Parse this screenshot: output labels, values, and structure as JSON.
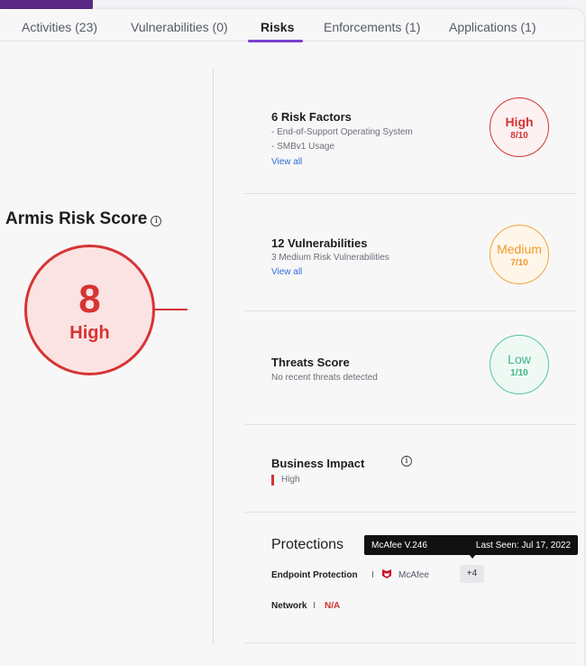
{
  "tabs": [
    {
      "label": "Activities (23)"
    },
    {
      "label": "Vulnerabilities (0)"
    },
    {
      "label": "Risks"
    },
    {
      "label": "Enforcements (1)"
    },
    {
      "label": "Applications (1)"
    }
  ],
  "active_tab": "Risks",
  "score": {
    "title": "Armis Risk Score",
    "info_icon": "i",
    "value": "8",
    "level": "High"
  },
  "risk_factors": {
    "title": "6 Risk Factors",
    "items": [
      "- End-of-Support Operating System",
      "- SMBv1 Usage"
    ],
    "link": "View all",
    "badge_level": "High",
    "badge_score": "8/10"
  },
  "vulnerabilities": {
    "title": "12 Vulnerabilities",
    "subtitle": "3 Medium Risk Vulnerabilities",
    "link": "View all",
    "badge_level": "Medium",
    "badge_score": "7/10"
  },
  "threats": {
    "title": "Threats Score",
    "subtitle": "No recent threats detected",
    "badge_level": "Low",
    "badge_score": "1/10"
  },
  "business_impact": {
    "title": "Business Impact",
    "info_icon": "i",
    "value": "High"
  },
  "protections": {
    "title": "Protections",
    "tooltip_version": "McAfee  V.246",
    "tooltip_seen": "Last Seen: Jul 17, 2022",
    "endpoint_label": "Endpoint Protection",
    "separator": "I",
    "endpoint_vendor": "McAfee",
    "more_chip": "+4",
    "network_label": "Network",
    "network_value": "N/A"
  },
  "colors": {
    "high": "#d63434",
    "medium": "#f2a53a",
    "low": "#59c49a",
    "accent": "#7a3fd1",
    "link": "#2f6fd8"
  }
}
